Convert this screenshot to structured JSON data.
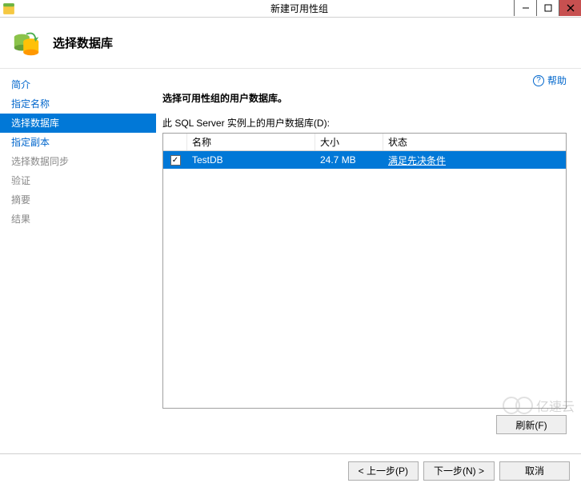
{
  "window": {
    "title": "新建可用性组",
    "header_title": "选择数据库"
  },
  "sidebar": {
    "items": [
      {
        "label": "简介",
        "state": "done"
      },
      {
        "label": "指定名称",
        "state": "done"
      },
      {
        "label": "选择数据库",
        "state": "active"
      },
      {
        "label": "指定副本",
        "state": "done"
      },
      {
        "label": "选择数据同步",
        "state": "pending"
      },
      {
        "label": "验证",
        "state": "pending"
      },
      {
        "label": "摘要",
        "state": "pending"
      },
      {
        "label": "结果",
        "state": "pending"
      }
    ]
  },
  "content": {
    "help_label": "帮助",
    "instruction": "选择可用性组的用户数据库。",
    "table_label": "此 SQL Server 实例上的用户数据库(D):",
    "columns": {
      "name": "名称",
      "size": "大小",
      "status": "状态"
    },
    "rows": [
      {
        "checked": true,
        "name": "TestDB",
        "size": "24.7 MB",
        "status": "满足先决条件",
        "selected": true
      }
    ],
    "refresh_label": "刷新(F)"
  },
  "footer": {
    "prev": "< 上一步(P)",
    "next": "下一步(N) >",
    "cancel": "取消"
  },
  "watermark": "亿速云"
}
